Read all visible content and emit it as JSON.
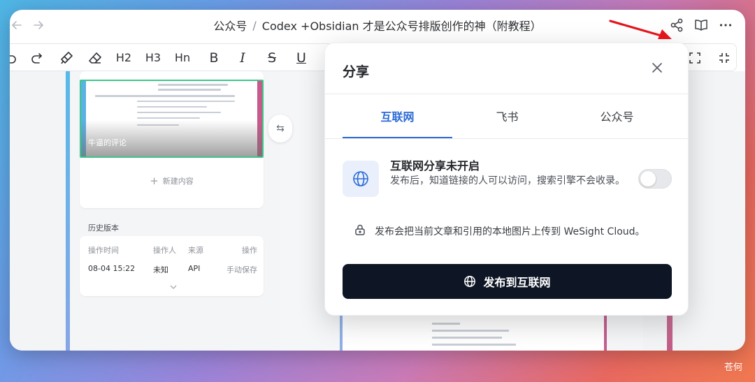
{
  "titlebar": {
    "breadcrumb_parent": "公众号",
    "separator": "/",
    "doc_title": "Codex +Obsidian 才是公众号排版创作的神（附教程）"
  },
  "toolbar": {
    "h2": "H2",
    "h3": "H3",
    "hn": "Hn",
    "bold": "B",
    "italic": "I",
    "strike": "S",
    "underline": "U"
  },
  "left_panel": {
    "thumbnail_caption": "牛逼的评论",
    "new_content": "新建内容",
    "history_title": "历史版本",
    "history_columns": [
      "操作时间",
      "操作人",
      "来源",
      "操作"
    ],
    "history_rows": [
      [
        "08-04 15:22",
        "未知",
        "API",
        "手动保存"
      ]
    ]
  },
  "share_dialog": {
    "title": "分享",
    "tabs": [
      {
        "label": "互联网",
        "active": true
      },
      {
        "label": "飞书",
        "active": false
      },
      {
        "label": "公众号",
        "active": false
      }
    ],
    "status_heading": "互联网分享未开启",
    "status_description": "发布后，知道链接的人可以访问，搜索引擎不会收录。",
    "toggle_on": false,
    "notice": "发布会把当前文章和引用的本地图片上传到 WeSight Cloud。",
    "publish_button": "发布到互联网",
    "accent_color": "#2d6bd7",
    "button_color": "#0e1626"
  },
  "annotation": {
    "arrow_color": "#e3141b"
  },
  "watermark": "苍何",
  "icons": {
    "back": "arrow-left-icon",
    "forward": "arrow-right-icon",
    "share": "share-icon",
    "reading": "book-open-icon",
    "more": "more-icon",
    "globe": "globe-icon",
    "lock": "lock-icon",
    "close": "close-icon"
  }
}
